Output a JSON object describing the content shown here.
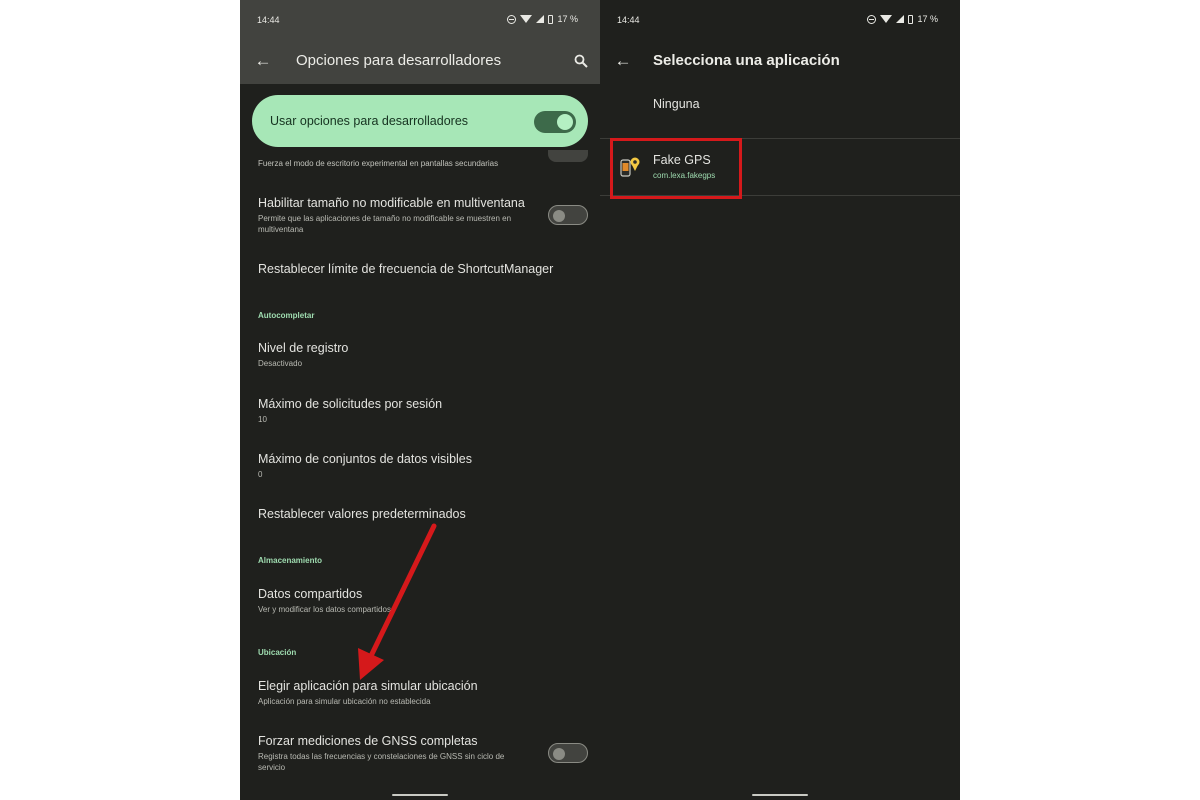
{
  "left_screen": {
    "status": {
      "time": "14:44",
      "battery": "17 %"
    },
    "app_bar": {
      "title": "Opciones para desarrolladores"
    },
    "master_toggle": {
      "label": "Usar opciones para desarrolladores"
    },
    "partial_text": "Fuerza el modo de escritorio experimental en pantallas secundarias",
    "settings": [
      {
        "title": "Habilitar tamaño no modificable en multiventana",
        "subtitle": "Permite que las aplicaciones de tamaño no modificable se muestren en multiventana"
      },
      {
        "title": "Restablecer límite de frecuencia de ShortcutManager"
      },
      {
        "title": "Nivel de registro",
        "subtitle": "Desactivado"
      },
      {
        "title": "Máximo de solicitudes por sesión",
        "subtitle": "10"
      },
      {
        "title": "Máximo de conjuntos de datos visibles",
        "subtitle": "0"
      },
      {
        "title": "Restablecer valores predeterminados"
      },
      {
        "title": "Datos compartidos",
        "subtitle": "Ver y modificar los datos compartidos"
      },
      {
        "title": "Elegir aplicación para simular ubicación",
        "subtitle": "Aplicación para simular ubicación no establecida"
      },
      {
        "title": "Forzar mediciones de GNSS completas",
        "subtitle": "Registra todas las frecuencias y constelaciones de GNSS sin ciclo de servicio"
      }
    ],
    "sections": {
      "autofill": "Autocompletar",
      "storage": "Almacenamiento",
      "location": "Ubicación"
    }
  },
  "right_screen": {
    "status": {
      "time": "14:44",
      "battery": "17 %"
    },
    "app_bar": {
      "title": "Selecciona una aplicación"
    },
    "none_option": "Ninguna",
    "app": {
      "name": "Fake GPS",
      "package": "com.lexa.fakegps"
    }
  },
  "colors": {
    "background": "#1f201d",
    "toolbar": "#42433f",
    "accent_green": "#a7e7b7",
    "section_green": "#9fdcb0",
    "annotation_red": "#d5191b"
  },
  "icons": [
    "back-arrow-icon",
    "search-icon",
    "do-not-disturb-icon",
    "wifi-icon",
    "signal-icon",
    "battery-icon",
    "fake-gps-app-icon"
  ]
}
